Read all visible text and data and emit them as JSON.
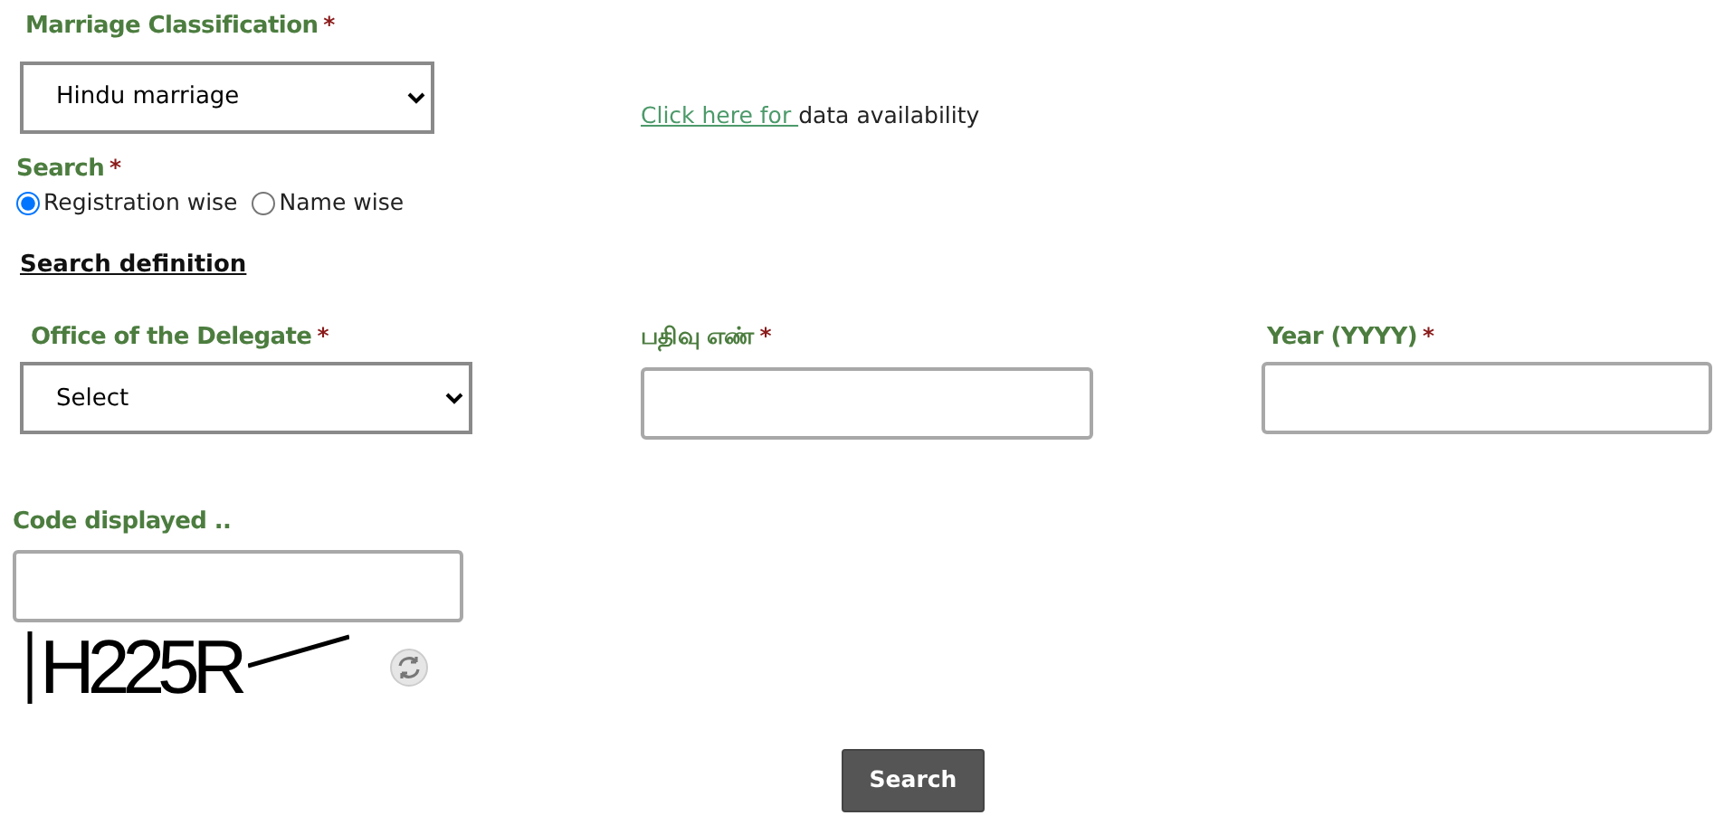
{
  "marriage_classification": {
    "label": "Marriage Classification",
    "required_mark": "*",
    "value": "Hindu marriage"
  },
  "availability_link": {
    "link": "Click here for ",
    "text": "data availability"
  },
  "search_type": {
    "label": "Search",
    "required_mark": "*",
    "options": [
      {
        "label": "Registration wise",
        "selected": true
      },
      {
        "label": "Name wise",
        "selected": false
      }
    ]
  },
  "section_heading": "Search definition",
  "fields": [
    {
      "kind": "select",
      "label": "Office of the Delegate",
      "required_mark": "*",
      "value": "Select"
    },
    {
      "kind": "text",
      "label": "பதிவு எண்",
      "required_mark": "*"
    },
    {
      "kind": "text",
      "label": "Year (YYYY)",
      "required_mark": "*"
    }
  ],
  "captcha": {
    "label": "Code displayed ..",
    "code": "H225R"
  },
  "submit": "Search"
}
